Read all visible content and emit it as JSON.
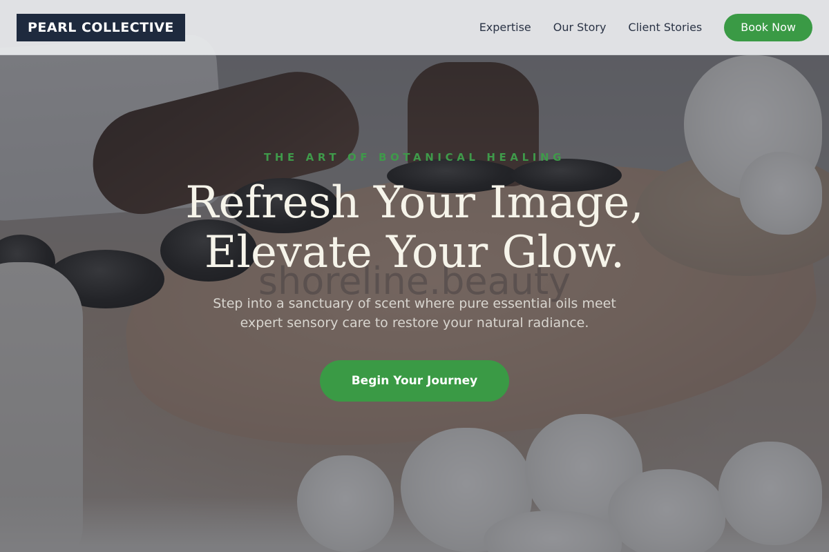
{
  "header": {
    "logo": "PEARL COLLECTIVE",
    "nav": [
      {
        "label": "Expertise"
      },
      {
        "label": "Our Story"
      },
      {
        "label": "Client Stories"
      }
    ],
    "cta_label": "Book Now"
  },
  "hero": {
    "eyebrow": "THE ART OF BOTANICAL HEALING",
    "headline_line1": "Refresh Your Image,",
    "headline_line2": "Elevate Your Glow.",
    "watermark": "shoreline.beauty",
    "subtext": "Step into a sanctuary of scent where pure essential oils meet expert sensory care to restore your natural radiance.",
    "cta_label": "Begin Your Journey",
    "background_image": "hot-stone massage with white orchids"
  },
  "colors": {
    "accent_green": "#3a9a45",
    "logo_bg": "#1e2a3e",
    "headline": "#f6f4ea",
    "nav_text": "#2a3345"
  }
}
